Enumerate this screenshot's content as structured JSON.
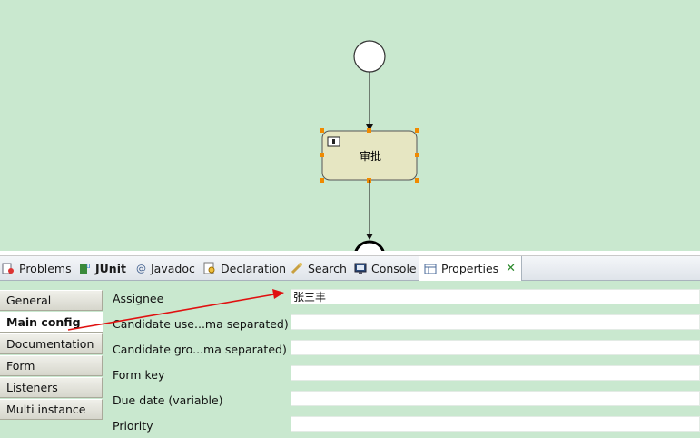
{
  "diagram": {
    "task_label": "审批"
  },
  "bottom_tabs": [
    {
      "label": "Problems",
      "icon": "problems-icon"
    },
    {
      "label": "JUnit",
      "icon": "junit-icon"
    },
    {
      "label": "Javadoc",
      "icon": "javadoc-icon"
    },
    {
      "label": "Declaration",
      "icon": "declaration-icon"
    },
    {
      "label": "Search",
      "icon": "search-icon"
    },
    {
      "label": "Console",
      "icon": "console-icon"
    },
    {
      "label": "Properties",
      "icon": "properties-icon",
      "active": true
    }
  ],
  "side_tabs": [
    {
      "label": "General"
    },
    {
      "label": "Main config",
      "active": true
    },
    {
      "label": "Documentation"
    },
    {
      "label": "Form"
    },
    {
      "label": "Listeners"
    },
    {
      "label": "Multi instance"
    }
  ],
  "main_config": {
    "rows": [
      {
        "label": "Assignee",
        "value": "张三丰"
      },
      {
        "label": "Candidate use...ma separated)",
        "value": ""
      },
      {
        "label": "Candidate gro...ma separated)",
        "value": ""
      },
      {
        "label": "Form key",
        "value": ""
      },
      {
        "label": "Due date (variable)",
        "value": ""
      },
      {
        "label": "Priority",
        "value": ""
      }
    ]
  },
  "colors": {
    "canvas_bg": "#c9e8cf",
    "task_fill": "#e6e6c2",
    "handle": "#f08a00",
    "annotation_arrow": "#e01010"
  }
}
